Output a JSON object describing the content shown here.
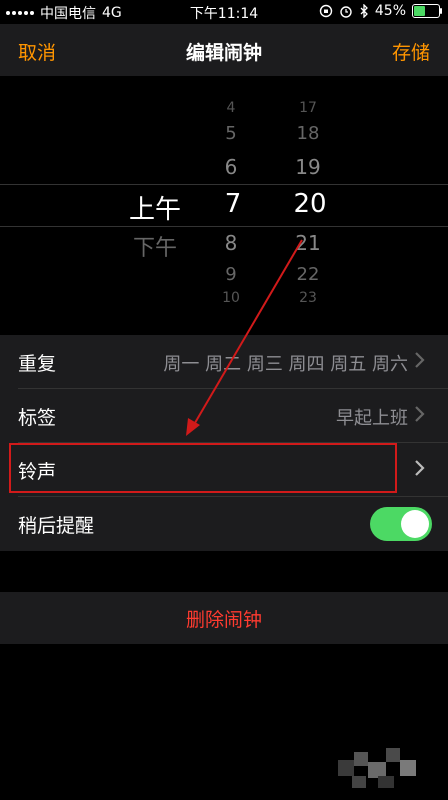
{
  "status_bar": {
    "carrier": "中国电信",
    "network": "4G",
    "time": "下午11:14",
    "battery": "45%",
    "battery_level": 0.45
  },
  "nav": {
    "cancel_label": "取消",
    "title": "编辑闹钟",
    "save_label": "存储"
  },
  "picker": {
    "ampm": {
      "selected": "上午",
      "below": "下午"
    },
    "hour": {
      "above": [
        "4",
        "5",
        "6"
      ],
      "selected": "7",
      "below": [
        "8",
        "9",
        "10"
      ]
    },
    "minute": {
      "above": [
        "17",
        "18",
        "19"
      ],
      "selected": "20",
      "below": [
        "21",
        "22",
        "23"
      ]
    }
  },
  "settings": {
    "repeat": {
      "label": "重复",
      "value": "周一 周二 周三 周四 周五 周六"
    },
    "tag": {
      "label": "标签",
      "value": "早起上班"
    },
    "ringtone": {
      "label": "铃声",
      "value": ""
    },
    "snooze": {
      "label": "稍后提醒",
      "enabled": true
    }
  },
  "delete_label": "删除闹钟",
  "colors": {
    "accent": "#ff9500",
    "toggle_on": "#4cd964",
    "destructive": "#ff3b30",
    "annotation": "#d11a1a"
  }
}
